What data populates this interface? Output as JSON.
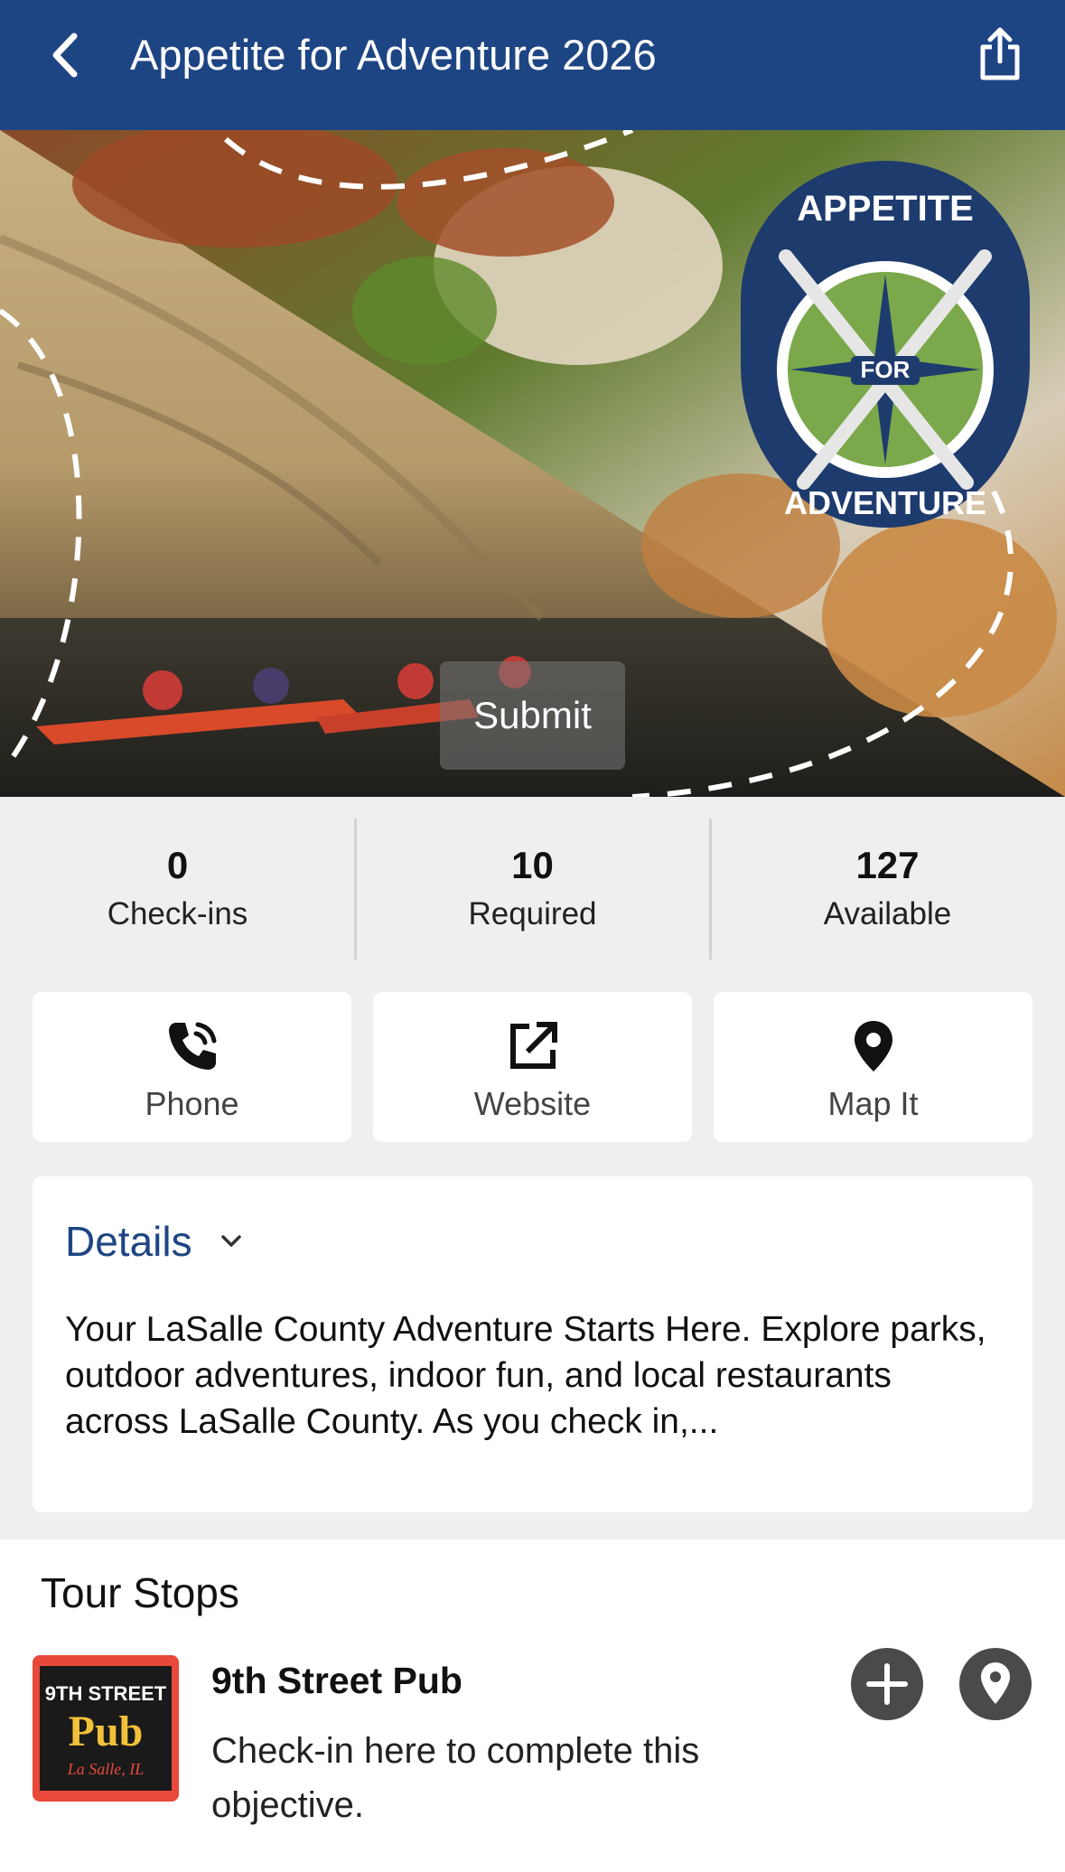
{
  "header": {
    "title": "Appetite for Adventure 2026",
    "back_icon": "chevron-left-icon",
    "share_icon": "share-icon",
    "bg_color": "#1e4583"
  },
  "hero": {
    "submit_label": "Submit",
    "logo_text_top": "APPETITE",
    "logo_text_mid": "FOR",
    "logo_text_bottom": "ADVENTURE"
  },
  "stats": [
    {
      "value": "0",
      "label": "Check-ins"
    },
    {
      "value": "10",
      "label": "Required"
    },
    {
      "value": "127",
      "label": "Available"
    }
  ],
  "actions": [
    {
      "label": "Phone",
      "icon": "phone-icon"
    },
    {
      "label": "Website",
      "icon": "external-link-icon"
    },
    {
      "label": "Map It",
      "icon": "map-pin-icon"
    }
  ],
  "details": {
    "heading": "Details",
    "text": "Your LaSalle County Adventure Starts Here. Explore parks, outdoor adventures, indoor fun, and local restaurants across LaSalle County. As you check in,..."
  },
  "tour_stops": {
    "heading": "Tour Stops",
    "items": [
      {
        "name": "9th Street Pub",
        "description": "Check-in here to complete this objective.",
        "logo_text": "9TH STREET Pub",
        "logo_subtext": "La Salle, IL"
      }
    ]
  },
  "colors": {
    "brand_blue": "#1e4583",
    "logo_green": "#7ba84a",
    "button_gray": "#4a4a4a"
  }
}
